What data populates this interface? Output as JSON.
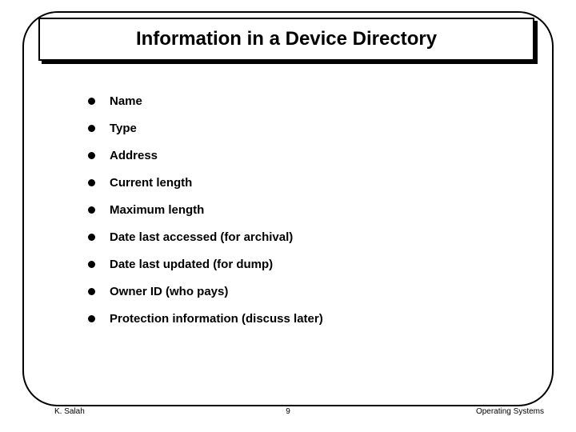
{
  "title": "Information in a Device Directory",
  "bullets": [
    "Name",
    "Type",
    "Address",
    "Current length",
    "Maximum length",
    "Date last accessed (for archival)",
    "Date last updated (for dump)",
    "Owner ID (who pays)",
    "Protection information (discuss later)"
  ],
  "footer": {
    "left": "K. Salah",
    "center": "9",
    "right": "Operating Systems"
  }
}
